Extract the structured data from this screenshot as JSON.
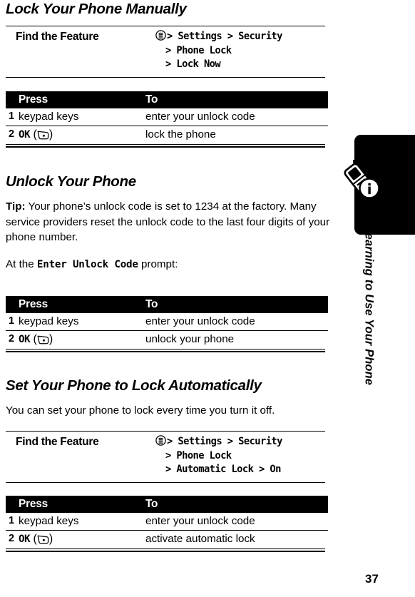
{
  "page": {
    "number": "37",
    "side_tab_label": "Learning to Use Your Phone"
  },
  "icons": {
    "menu": "menu-key-icon",
    "softkey": "left-soft-key-icon",
    "phone_info": "phone-info-icon"
  },
  "sections": [
    {
      "heading": "Lock Your Phone Manually",
      "find_the_feature": {
        "label": "Find the Feature",
        "menu_icon": "menu-key-icon",
        "path_line1": "> Settings > Security",
        "path_line2": "> Phone Lock",
        "path_line3": "> Lock Now"
      },
      "table": {
        "headers": [
          "",
          "Press",
          "To"
        ],
        "rows": [
          {
            "num": "1",
            "press": "keypad keys",
            "press_icon": "",
            "to": "enter your unlock code"
          },
          {
            "num": "2",
            "press": "OK",
            "press_icon": "left-soft-key-icon",
            "to": "lock the phone"
          }
        ]
      }
    },
    {
      "heading": "Unlock Your Phone",
      "tip_label": "Tip:",
      "tip_text": " Your phone’s unlock code is set to 1234 at the factory. Many service providers reset the unlock code to the last four digits of your phone number.",
      "prompt_prefix": "At the ",
      "prompt_mono": "Enter Unlock Code",
      "prompt_suffix": " prompt:",
      "table": {
        "headers": [
          "",
          "Press",
          "To"
        ],
        "rows": [
          {
            "num": "1",
            "press": "keypad keys",
            "press_icon": "",
            "to": "enter your unlock code"
          },
          {
            "num": "2",
            "press": "OK",
            "press_icon": "left-soft-key-icon",
            "to": "unlock your phone"
          }
        ]
      }
    },
    {
      "heading": "Set Your Phone to Lock Automatically",
      "intro": "You can set your phone to lock every time you turn it off.",
      "find_the_feature": {
        "label": "Find the Feature",
        "menu_icon": "menu-key-icon",
        "path_line1": "> Settings > Security",
        "path_line2": "> Phone Lock",
        "path_line3": "> Automatic Lock > On"
      },
      "table": {
        "headers": [
          "",
          "Press",
          "To"
        ],
        "rows": [
          {
            "num": "1",
            "press": "keypad keys",
            "press_icon": "",
            "to": "enter your unlock code"
          },
          {
            "num": "2",
            "press": "OK",
            "press_icon": "left-soft-key-icon",
            "to": "activate automatic lock"
          }
        ]
      }
    }
  ],
  "colors": {
    "ink": "#000000",
    "paper": "#ffffff",
    "table_header_bg": "#000000",
    "table_header_fg": "#ffffff"
  }
}
